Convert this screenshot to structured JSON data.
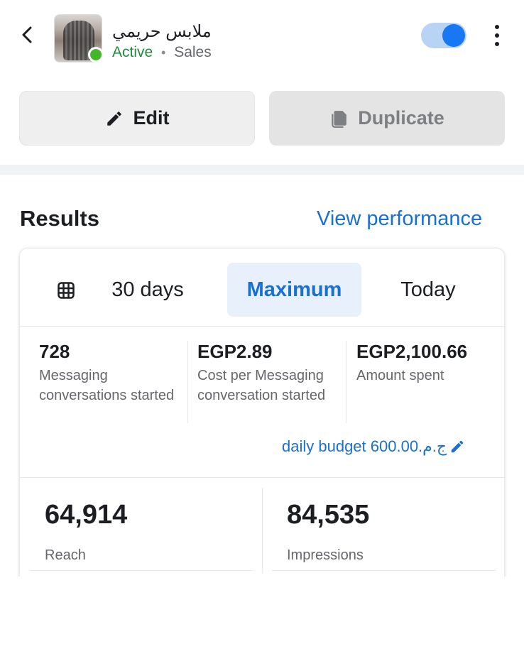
{
  "header": {
    "title": "ملابس حريمي",
    "status": "Active",
    "separator": "•",
    "objective": "Sales",
    "toggle_on": true
  },
  "actions": {
    "edit_label": "Edit",
    "duplicate_label": "Duplicate"
  },
  "results": {
    "title": "Results",
    "view_performance_label": "View performance",
    "date_ranges": [
      "30 days",
      "Maximum",
      "Today"
    ],
    "selected_range": "Maximum",
    "metrics": [
      {
        "value": "728",
        "label": "Messaging conversations started"
      },
      {
        "value": "EGP2.89",
        "label": "Cost per Messaging conversation started"
      },
      {
        "value": "EGP2,100.66",
        "label": "Amount spent"
      }
    ],
    "budget_text": "daily budget 600.00.ج.م",
    "big_metrics": [
      {
        "value": "64,914",
        "label": "Reach"
      },
      {
        "value": "84,535",
        "label": "Impressions"
      }
    ]
  },
  "colors": {
    "accent": "#1a6fd1",
    "active_green": "#1e8e3e",
    "toggle_blue": "#1877f2"
  },
  "icons": {
    "back": "chevron-left-icon",
    "more": "kebab-menu-icon",
    "edit": "pencil-icon",
    "duplicate": "copy-icon",
    "calendar": "calendar-grid-icon",
    "budget_edit": "pencil-icon"
  }
}
